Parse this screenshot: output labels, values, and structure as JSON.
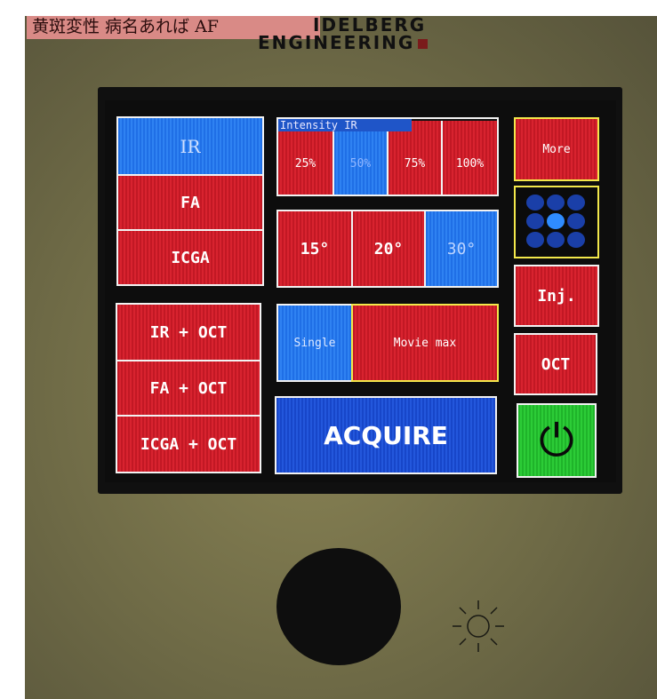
{
  "sticker_text": "黄斑変性 病名あれば AF",
  "brand": {
    "line1": "IDELBERG",
    "line2": "ENGINEERING"
  },
  "modes": {
    "ir": "IR",
    "fa": "FA",
    "icga": "ICGA",
    "ir_oct": "IR + OCT",
    "fa_oct": "FA + OCT",
    "icga_oct": "ICGA + OCT",
    "selected": "IR"
  },
  "intensity": {
    "title": "Intensity IR",
    "options": [
      "25%",
      "50%",
      "75%",
      "100%"
    ],
    "selected": "50%"
  },
  "field_of_view": {
    "options": [
      "15°",
      "20°",
      "30°"
    ],
    "selected": "30°"
  },
  "capture_mode": {
    "single": "Single",
    "movie": "Movie max",
    "selected": "Single"
  },
  "acquire_label": "ACQUIRE",
  "right_buttons": {
    "more": "More",
    "inj": "Inj.",
    "oct": "OCT",
    "power_symbol": "⏻"
  },
  "fixation": {
    "selected_index": 4
  },
  "colors": {
    "button_red": "#d8232f",
    "button_blue": "#2f82f2",
    "acquire_blue": "#2357dc",
    "power_green": "#2ccc37",
    "highlight_yellow": "#f3e84b"
  }
}
